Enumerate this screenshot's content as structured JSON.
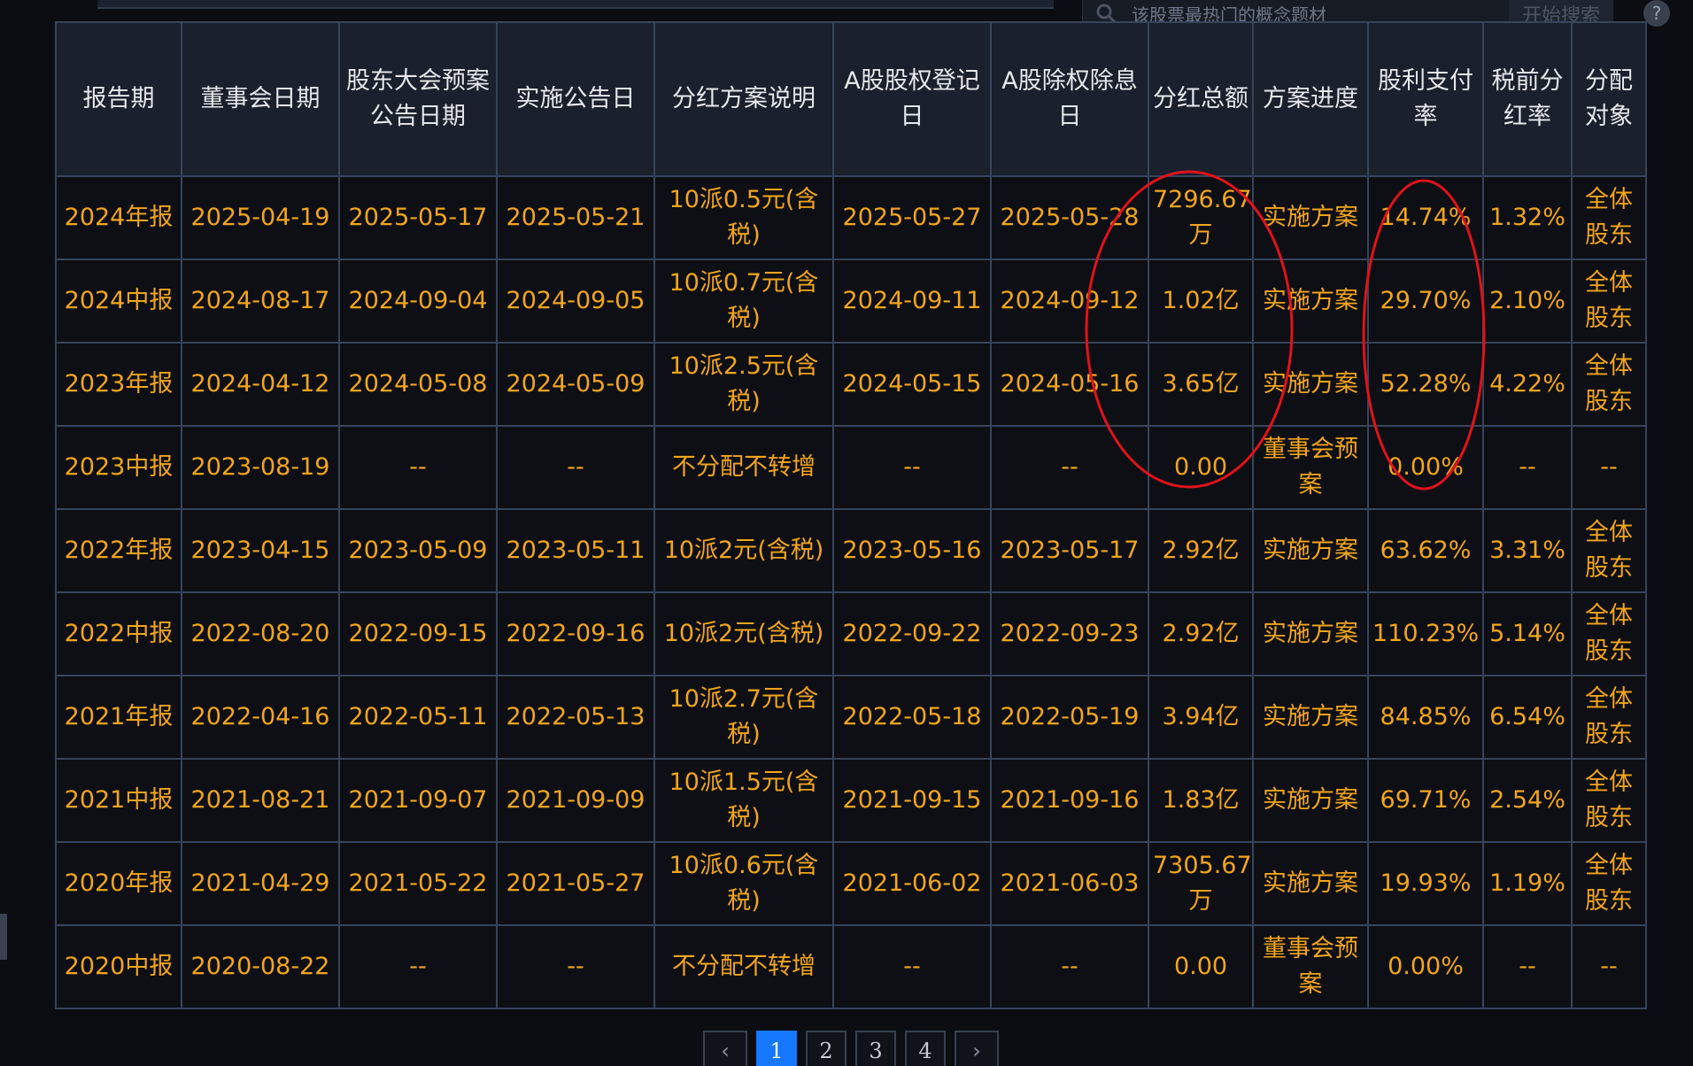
{
  "search": {
    "placeholder": "该股票最热门的概念题材",
    "button_label": "开始搜索",
    "help_label": "?"
  },
  "table": {
    "headers": [
      "报告期",
      "董事会日期",
      "股东大会预案公告日期",
      "实施公告日",
      "分红方案说明",
      "A股股权登记日",
      "A股除权除息日",
      "分红总额",
      "方案进度",
      "股利支付率",
      "税前分红率",
      "分配对象"
    ],
    "rows": [
      [
        "2024年报",
        "2025-04-19",
        "2025-05-17",
        "2025-05-21",
        "10派0.5元(含税)",
        "2025-05-27",
        "2025-05-28",
        "7296.67万",
        "实施方案",
        "14.74%",
        "1.32%",
        "全体股东"
      ],
      [
        "2024中报",
        "2024-08-17",
        "2024-09-04",
        "2024-09-05",
        "10派0.7元(含税)",
        "2024-09-11",
        "2024-09-12",
        "1.02亿",
        "实施方案",
        "29.70%",
        "2.10%",
        "全体股东"
      ],
      [
        "2023年报",
        "2024-04-12",
        "2024-05-08",
        "2024-05-09",
        "10派2.5元(含税)",
        "2024-05-15",
        "2024-05-16",
        "3.65亿",
        "实施方案",
        "52.28%",
        "4.22%",
        "全体股东"
      ],
      [
        "2023中报",
        "2023-08-19",
        "--",
        "--",
        "不分配不转增",
        "--",
        "--",
        "0.00",
        "董事会预案",
        "0.00%",
        "--",
        "--"
      ],
      [
        "2022年报",
        "2023-04-15",
        "2023-05-09",
        "2023-05-11",
        "10派2元(含税)",
        "2023-05-16",
        "2023-05-17",
        "2.92亿",
        "实施方案",
        "63.62%",
        "3.31%",
        "全体股东"
      ],
      [
        "2022中报",
        "2022-08-20",
        "2022-09-15",
        "2022-09-16",
        "10派2元(含税)",
        "2022-09-22",
        "2022-09-23",
        "2.92亿",
        "实施方案",
        "110.23%",
        "5.14%",
        "全体股东"
      ],
      [
        "2021年报",
        "2022-04-16",
        "2022-05-11",
        "2022-05-13",
        "10派2.7元(含税)",
        "2022-05-18",
        "2022-05-19",
        "3.94亿",
        "实施方案",
        "84.85%",
        "6.54%",
        "全体股东"
      ],
      [
        "2021中报",
        "2021-08-21",
        "2021-09-07",
        "2021-09-09",
        "10派1.5元(含税)",
        "2021-09-15",
        "2021-09-16",
        "1.83亿",
        "实施方案",
        "69.71%",
        "2.54%",
        "全体股东"
      ],
      [
        "2020年报",
        "2021-04-29",
        "2021-05-22",
        "2021-05-27",
        "10派0.6元(含税)",
        "2021-06-02",
        "2021-06-03",
        "7305.67万",
        "实施方案",
        "19.93%",
        "1.19%",
        "全体股东"
      ],
      [
        "2020中报",
        "2020-08-22",
        "--",
        "--",
        "不分配不转增",
        "--",
        "--",
        "0.00",
        "董事会预案",
        "0.00%",
        "--",
        "--"
      ]
    ]
  },
  "pagination": {
    "prev_icon": "‹",
    "pages": [
      "1",
      "2",
      "3",
      "4"
    ],
    "next_icon": "›",
    "current": "1"
  },
  "colors": {
    "cell_text": "#f2a51c",
    "header_text": "#e6e8ec",
    "border": "#37445a",
    "annotation": "#e0121b",
    "active_page": "#1677ff"
  },
  "icons": {
    "search": "search-icon",
    "help": "help-icon",
    "prev": "chevron-left-icon",
    "next": "chevron-right-icon"
  }
}
